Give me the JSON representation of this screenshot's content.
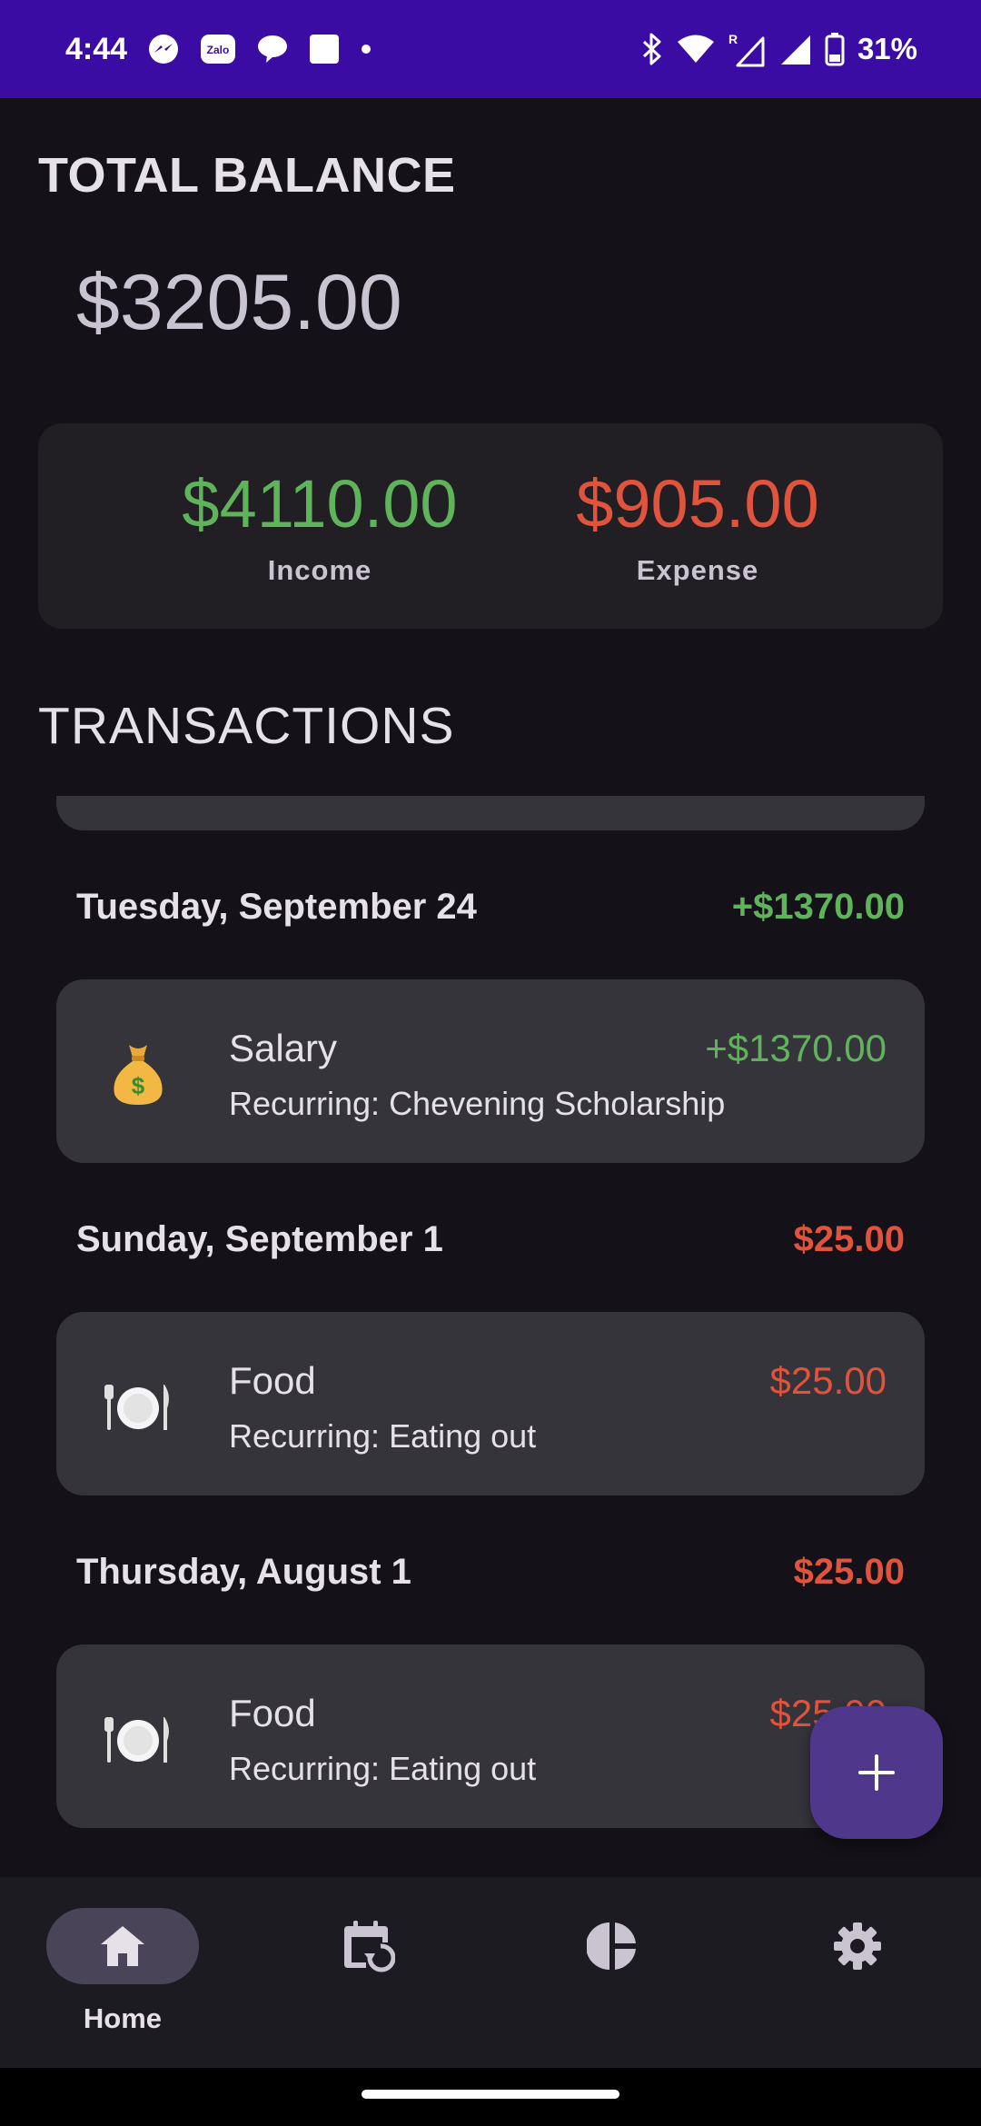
{
  "status_bar": {
    "time": "4:44",
    "notification_icons": [
      "messenger-icon",
      "zalo-icon",
      "chat-bubble-icon",
      "square-app-icon",
      "dot-icon"
    ],
    "zalo_text": "Zalo",
    "roaming_label": "R",
    "battery": "31%"
  },
  "header": {
    "title": "TOTAL BALANCE",
    "balance": "$3205.00"
  },
  "summary": {
    "income_value": "$4110.00",
    "income_label": "Income",
    "expense_value": "$905.00",
    "expense_label": "Expense"
  },
  "transactions": {
    "title": "TRANSACTIONS",
    "groups": [
      {
        "date": "Tuesday, September 24",
        "total": "+$1370.00",
        "items": [
          {
            "icon": "money-bag-icon",
            "category": "Salary",
            "note": "Recurring: Chevening Scholarship",
            "amount": "+$1370.00"
          }
        ]
      },
      {
        "date": "Sunday, September 1",
        "total": "$25.00",
        "items": [
          {
            "icon": "plate-cutlery-icon",
            "category": "Food",
            "note": "Recurring: Eating out",
            "amount": "$25.00"
          }
        ]
      },
      {
        "date": "Thursday, August 1",
        "total": "$25.00",
        "items": [
          {
            "icon": "plate-cutlery-icon",
            "category": "Food",
            "note": "Recurring: Eating out",
            "amount": "$25.00"
          }
        ]
      }
    ]
  },
  "fab": {
    "icon": "plus-icon"
  },
  "bottom_nav": {
    "items": [
      {
        "icon": "home-icon",
        "label": "Home",
        "active": true
      },
      {
        "icon": "calendar-recurring-icon",
        "label": "",
        "active": false
      },
      {
        "icon": "pie-chart-icon",
        "label": "",
        "active": false
      },
      {
        "icon": "gear-icon",
        "label": "",
        "active": false
      }
    ]
  },
  "colors": {
    "status_bar": "#3a0ca3",
    "background": "#141218",
    "card": "#36343b",
    "summary_card": "#211f24",
    "income": "#5fb35b",
    "expense": "#e0533c",
    "fab": "#4f378b",
    "nav_indicator": "#4a4458"
  }
}
